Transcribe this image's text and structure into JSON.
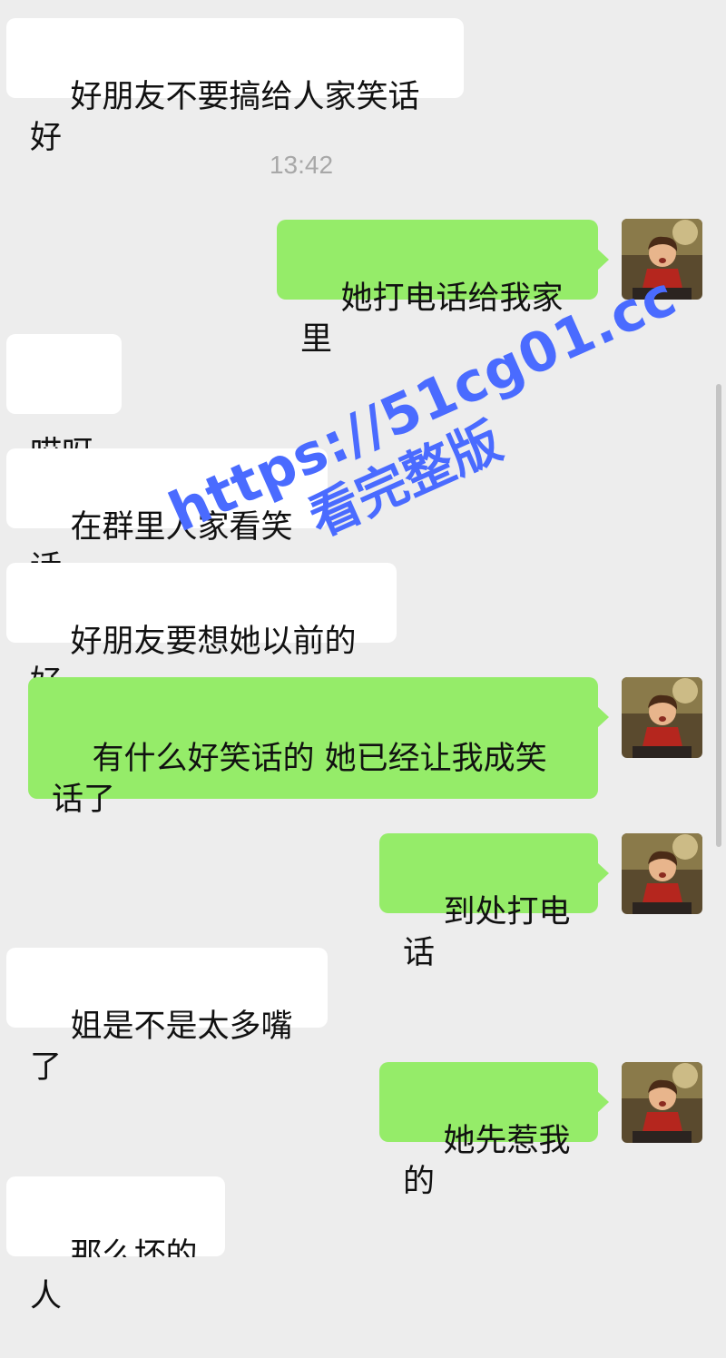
{
  "timestamp": "13:42",
  "messages": [
    {
      "side": "in",
      "text": "好朋友不要搞给人家笑话好"
    },
    {
      "side": "out",
      "text": "她打电话给我家里"
    },
    {
      "side": "in",
      "text": "哎呀"
    },
    {
      "side": "in",
      "text": "在群里人家看笑话"
    },
    {
      "side": "in",
      "text": "好朋友要想她以前的好"
    },
    {
      "side": "out",
      "text": "有什么好笑话的 她已经让我成笑话了"
    },
    {
      "side": "out",
      "text": "到处打电话"
    },
    {
      "side": "in",
      "text": "姐是不是太多嘴了"
    },
    {
      "side": "out",
      "text": "她先惹我的"
    },
    {
      "side": "in",
      "text": "那么坏的人"
    }
  ],
  "watermark": {
    "line1": "https://51cg01.cc",
    "line2": "看完整版"
  },
  "colors": {
    "background": "#ededed",
    "incoming_bubble": "#ffffff",
    "outgoing_bubble": "#95ec69",
    "watermark": "#4a6bff"
  }
}
